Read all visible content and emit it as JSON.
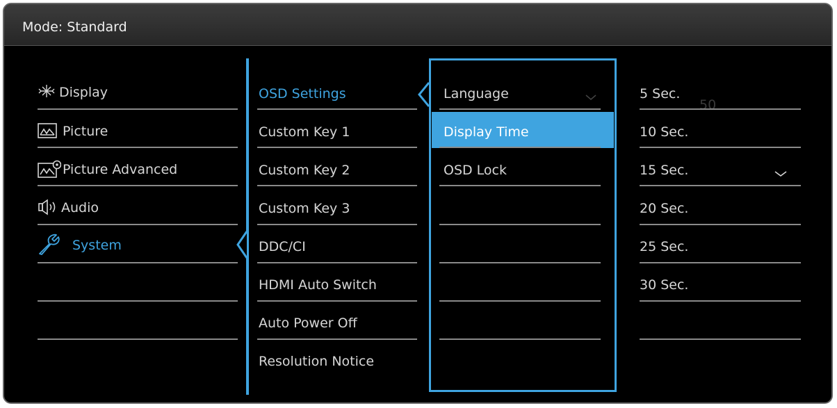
{
  "header": {
    "title": "Mode: Standard"
  },
  "menu": {
    "items": [
      {
        "label": "Display",
        "icon": "display-icon"
      },
      {
        "label": "Picture",
        "icon": "picture-icon"
      },
      {
        "label": "Picture Advanced",
        "icon": "picture-advanced-icon"
      },
      {
        "label": "Audio",
        "icon": "audio-icon"
      },
      {
        "label": "System",
        "icon": "system-icon"
      }
    ],
    "active": "System"
  },
  "submenu": {
    "items": [
      {
        "label": "OSD Settings"
      },
      {
        "label": "Custom Key 1"
      },
      {
        "label": "Custom Key 2"
      },
      {
        "label": "Custom Key 3"
      },
      {
        "label": "DDC/CI"
      },
      {
        "label": "HDMI Auto Switch"
      },
      {
        "label": "Auto Power Off"
      },
      {
        "label": "Resolution Notice"
      }
    ],
    "active": "OSD Settings"
  },
  "osd": {
    "items": [
      {
        "label": "Language"
      },
      {
        "label": "Display Time"
      },
      {
        "label": "OSD Lock"
      }
    ],
    "selected": "Display Time"
  },
  "values": {
    "items": [
      {
        "label": "5 Sec."
      },
      {
        "label": "10 Sec."
      },
      {
        "label": "15 Sec."
      },
      {
        "label": "20 Sec."
      },
      {
        "label": "25 Sec."
      },
      {
        "label": "30 Sec."
      }
    ],
    "checked": "15 Sec."
  },
  "overlay": {
    "ghost_number": "50"
  },
  "colors": {
    "accent": "#3fa4e0",
    "background": "#000000",
    "text": "#d6d6d6",
    "line": "#8a8a8a"
  }
}
